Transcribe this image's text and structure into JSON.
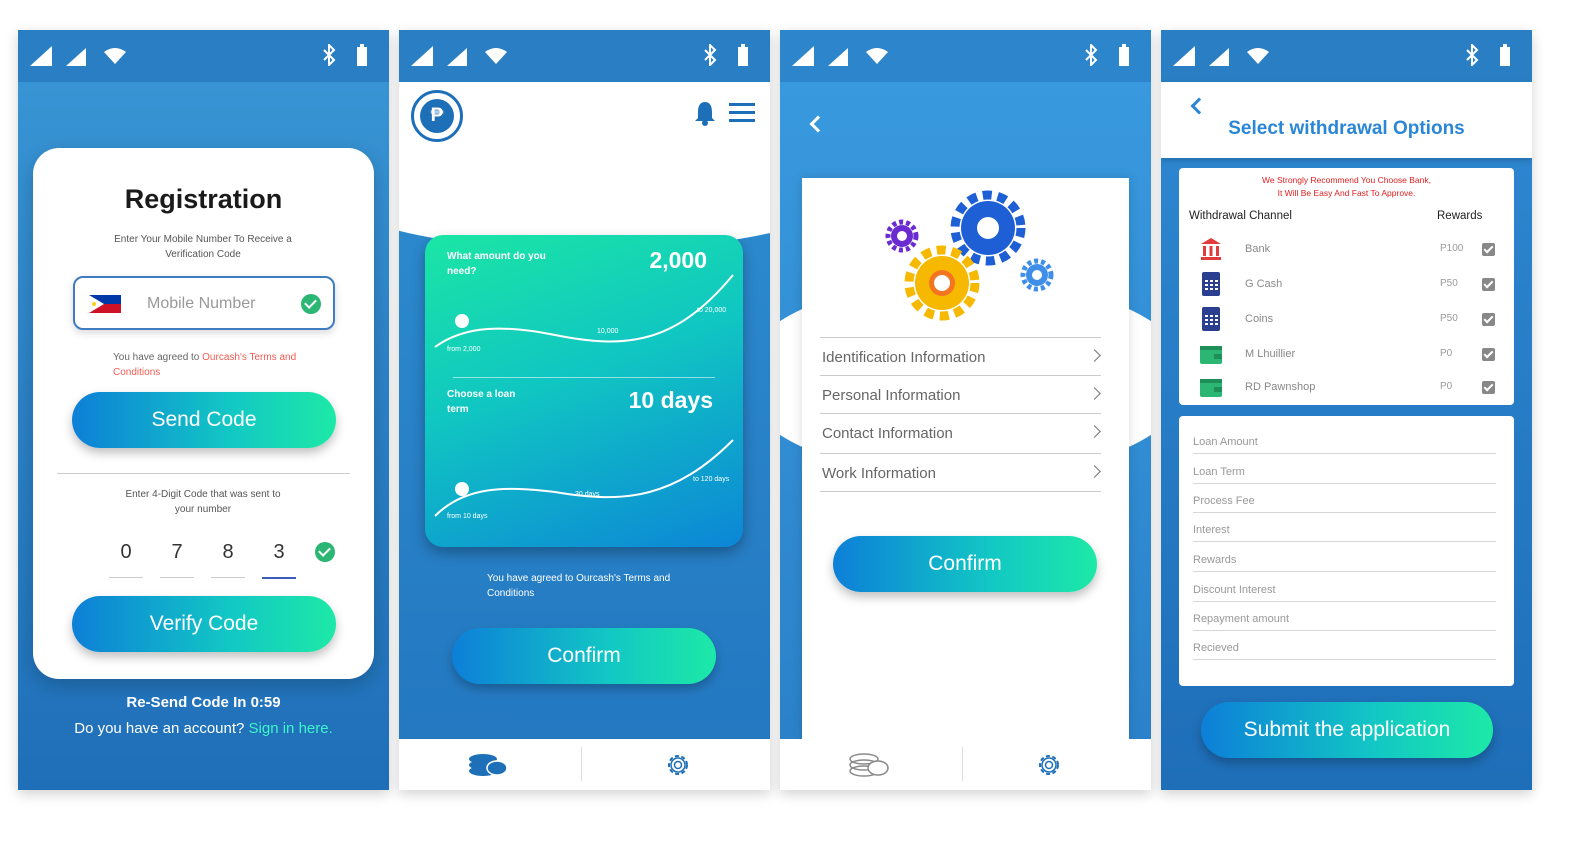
{
  "colors": {
    "primary": "#2a7fc4",
    "accent_start": "#0d7fd8",
    "accent_end": "#1de9a7",
    "link_red": "#f25c54",
    "link_teal": "#3df5c9",
    "title_blue": "#2a86d6"
  },
  "status_icons": [
    "signal-icon",
    "signal-icon",
    "wifi-icon",
    "bluetooth-icon",
    "battery-icon"
  ],
  "registration": {
    "title": "Registration",
    "subtitle": "Enter Your Mobile Number To Receive a Verification Code",
    "mobile_placeholder": "Mobile Number",
    "terms_prefix": "You have agreed to ",
    "terms_link": "Ourcash's Terms and Conditions",
    "send_code": "Send Code",
    "code_subtitle": "Enter 4-Digit Code that was sent to your number",
    "digits": [
      "0",
      "7",
      "8",
      "3"
    ],
    "verify_code": "Verify Code",
    "resend": "Re-Send Code In 0:59",
    "account_prefix": "Do you have an account?",
    "sign_in": "Sign in here."
  },
  "loan": {
    "amount_label": "What amount do you need?",
    "amount_value": "2,000",
    "amount_min": "from 2,000",
    "amount_mid": "10,000",
    "amount_max": "to 20,000",
    "term_label": "Choose a loan term",
    "term_value": "10 days",
    "term_min": "from 10 days",
    "term_mid": "30 days",
    "term_max": "to 120 days",
    "terms": "You have agreed to Ourcash's Terms and Conditions",
    "confirm": "Confirm"
  },
  "info": {
    "items": [
      "Identification Information",
      "Personal Information",
      "Contact Information",
      "Work Information"
    ],
    "confirm": "Confirm"
  },
  "withdrawal": {
    "title": "Select withdrawal Options",
    "warning_line1": "We Strongly Recommend You Choose Bank,",
    "warning_line2": "It Will Be Easy And Fast To Approve.",
    "channel_header": "Withdrawal Channel",
    "rewards_header": "Rewards",
    "channels": [
      {
        "name": "Bank",
        "reward": "P100",
        "icon": "bank-icon"
      },
      {
        "name": "G Cash",
        "reward": "P50",
        "icon": "phone-icon"
      },
      {
        "name": "Coins",
        "reward": "P50",
        "icon": "phone-icon"
      },
      {
        "name": "M Lhuillier",
        "reward": "P0",
        "icon": "wallet-icon"
      },
      {
        "name": "RD Pawnshop",
        "reward": "P0",
        "icon": "wallet-icon"
      }
    ],
    "fields": [
      "Loan Amount",
      "Loan Term",
      "Process Fee",
      "Interest",
      "Rewards",
      "Discount Interest",
      "Repayment amount",
      "Recieved"
    ],
    "submit": "Submit the application"
  }
}
